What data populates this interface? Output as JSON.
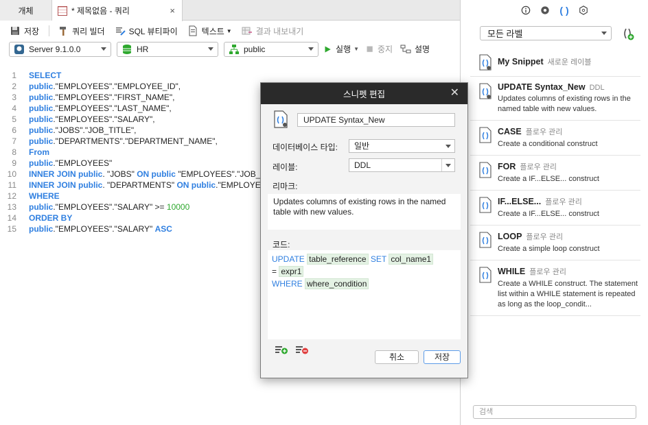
{
  "tabs": {
    "objects_label": "개체",
    "query_label": "* 제목없음 - 쿼리",
    "close_glyph": "×"
  },
  "toolbar": {
    "save_label": "저장",
    "query_builder_label": "쿼리 빌더",
    "sql_beautify_label": "SQL 뷰티파이",
    "text_label": "텍스트",
    "export_label": "결과 내보내기",
    "run_label": "실행",
    "stop_label": "중지",
    "explain_label": "설명"
  },
  "connection": {
    "server": "Server 9.1.0.0",
    "database": "HR",
    "schema": "public"
  },
  "editor": {
    "lines": [
      {
        "n": "1",
        "parts": [
          {
            "t": "SELECT",
            "k": "kw"
          }
        ]
      },
      {
        "n": "2",
        "parts": [
          {
            "t": "public",
            "k": "kw"
          },
          {
            "t": ".\"EMPLOYEES\".\"EMPLOYEE_ID\",",
            "k": "txt"
          }
        ]
      },
      {
        "n": "3",
        "parts": [
          {
            "t": "public",
            "k": "kw"
          },
          {
            "t": ".\"EMPLOYEES\".\"FIRST_NAME\",",
            "k": "txt"
          }
        ]
      },
      {
        "n": "4",
        "parts": [
          {
            "t": "public",
            "k": "kw"
          },
          {
            "t": ".\"EMPLOYEES\".\"LAST_NAME\",",
            "k": "txt"
          }
        ]
      },
      {
        "n": "5",
        "parts": [
          {
            "t": "public",
            "k": "kw"
          },
          {
            "t": ".\"EMPLOYEES\".\"SALARY\",",
            "k": "txt"
          }
        ]
      },
      {
        "n": "6",
        "parts": [
          {
            "t": "public",
            "k": "kw"
          },
          {
            "t": ".\"JOBS\".\"JOB_TITLE\",",
            "k": "txt"
          }
        ]
      },
      {
        "n": "7",
        "parts": [
          {
            "t": "public",
            "k": "kw"
          },
          {
            "t": ".\"DEPARTMENTS\".\"DEPARTMENT_NAME\",",
            "k": "txt"
          }
        ]
      },
      {
        "n": "8",
        "parts": [
          {
            "t": "From",
            "k": "kw"
          }
        ]
      },
      {
        "n": "9",
        "parts": [
          {
            "t": "public",
            "k": "kw"
          },
          {
            "t": ".\"EMPLOYEES\"",
            "k": "txt"
          }
        ]
      },
      {
        "n": "10",
        "parts": [
          {
            "t": "INNER JOIN public",
            "k": "kw"
          },
          {
            "t": ". \"JOBS\" ",
            "k": "txt"
          },
          {
            "t": "ON public",
            "k": "kw"
          },
          {
            "t": " \"EMPLOYEES\".\"JOB_ID",
            "k": "txt"
          }
        ]
      },
      {
        "n": "11",
        "parts": [
          {
            "t": "INNER JOIN public",
            "k": "kw"
          },
          {
            "t": ". \"DEPARTMENTS\" ",
            "k": "txt"
          },
          {
            "t": "ON public",
            "k": "kw"
          },
          {
            "t": ".\"EMPLOYE",
            "k": "txt"
          }
        ]
      },
      {
        "n": "12",
        "parts": [
          {
            "t": "WHERE",
            "k": "kw"
          }
        ]
      },
      {
        "n": "13",
        "parts": [
          {
            "t": "public",
            "k": "kw"
          },
          {
            "t": ".\"EMPLOYEES\".\"SALARY\" >= ",
            "k": "txt"
          },
          {
            "t": "10000",
            "k": "num"
          }
        ]
      },
      {
        "n": "14",
        "parts": [
          {
            "t": "ORDER BY",
            "k": "kw"
          }
        ]
      },
      {
        "n": "15",
        "parts": [
          {
            "t": "public",
            "k": "kw"
          },
          {
            "t": ".\"EMPLOYEES\".\"SALARY\" ",
            "k": "txt"
          },
          {
            "t": "ASC",
            "k": "kw"
          }
        ]
      }
    ]
  },
  "right_panel": {
    "label_filter": "모든 라벨",
    "search_placeholder": "검색",
    "snippets": [
      {
        "name": "My Snippet",
        "label": "새로운 레이블",
        "desc": ""
      },
      {
        "name": "UPDATE Syntax_New",
        "label": "DDL",
        "desc": "Updates columns of existing rows in the named table with new values."
      },
      {
        "name": "CASE",
        "label": "플로우 관리",
        "desc": "Create a conditional construct"
      },
      {
        "name": "FOR",
        "label": "플로우 관리",
        "desc": "Create a IF...ELSE... construct"
      },
      {
        "name": "IF...ELSE...",
        "label": "플로우 관리",
        "desc": "Create a IF...ELSE... construct"
      },
      {
        "name": "LOOP",
        "label": "플로우 관리",
        "desc": "Create a simple loop construct"
      },
      {
        "name": "WHILE",
        "label": "플로우 관리",
        "desc": "Create a WHILE construct. The statement list within a WHILE statement is repeated as long as the loop_condit..."
      }
    ]
  },
  "dialog": {
    "title": "스니펫 편집",
    "close_glyph": "✕",
    "name_value": "UPDATE Syntax_New",
    "db_type_label": "데이터베이스 타입:",
    "db_type_value": "일반",
    "label_label": "레이블:",
    "label_value": "DDL",
    "remark_label": "리마크:",
    "remark_value": "Updates columns of existing rows in the named table with new values.",
    "code_label": "코드:",
    "code": {
      "kw_update": "UPDATE",
      "ph_table": "table_reference",
      "kw_set": "SET",
      "ph_col": "col_name1",
      "eq": "=",
      "ph_expr": "expr1",
      "kw_where": "WHERE",
      "ph_where": "where_condition"
    },
    "cancel_label": "취소",
    "save_label": "저장"
  },
  "colors": {
    "keyword": "#2f7fe0",
    "number": "#2ea82e",
    "dialog_title_bg": "#2a2a2a",
    "placeholder_bg": "#e4f2e4"
  },
  "icons": {
    "save": "save-icon",
    "query_builder": "hammer-icon",
    "beautify": "beautify-icon",
    "text": "document-icon",
    "export": "export-icon",
    "run": "play-icon",
    "stop": "stop-icon",
    "explain": "explain-icon",
    "snippet": "snippet-file-icon"
  }
}
